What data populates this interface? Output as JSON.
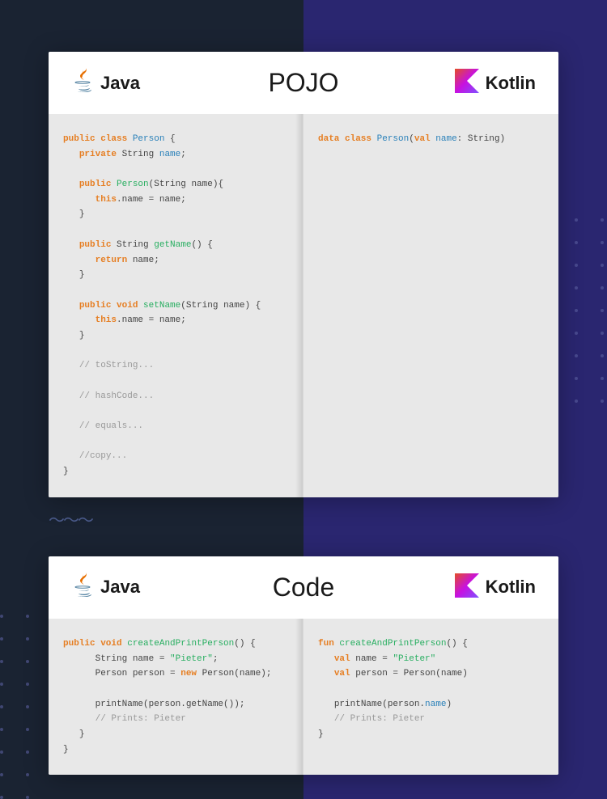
{
  "card1": {
    "title": "POJO",
    "javaLabel": "Java",
    "kotlinLabel": "Kotlin",
    "javaCode": "<span class='kw'>public class</span> <span class='cls'>Person</span> {\n   <span class='kw'>private</span> String <span class='cls'>name</span>;\n\n   <span class='kw'>public</span> <span class='fn'>Person</span>(String name){\n      <span class='kw'>this</span>.name = name;\n   }\n\n   <span class='kw'>public</span> String <span class='fn'>getName</span>() {\n      <span class='kw'>return</span> name;\n   }\n\n   <span class='kw'>public void</span> <span class='fn'>setName</span>(String name) {\n      <span class='kw'>this</span>.name = name;\n   }\n\n   <span class='cmt'>// toString...</span>\n\n   <span class='cmt'>// hashCode...</span>\n\n   <span class='cmt'>// equals...</span>\n\n   <span class='cmt'>//copy...</span>\n}",
    "kotlinCode": "<span class='kw'>data class</span> <span class='cls'>Person</span>(<span class='kw'>val</span> <span class='cls'>name</span>: String)"
  },
  "card2": {
    "title": "Code",
    "javaLabel": "Java",
    "kotlinLabel": "Kotlin",
    "javaCode": "<span class='kw'>public void</span> <span class='fn'>createAndPrintPerson</span>() {\n      String name = <span class='str'>\"Pieter\"</span>;\n      Person person = <span class='kw'>new</span> Person(name);\n\n      printName(person.getName());\n      <span class='cmt'>// Prints: Pieter</span>\n   }\n}",
    "kotlinCode": "<span class='kw'>fun</span> <span class='fn'>createAndPrintPerson</span>() {\n   <span class='kw'>val</span> name = <span class='str'>\"Pieter\"</span>\n   <span class='kw'>val</span> person = Person(name)\n\n   printName(person.<span class='cls'>name</span>)\n   <span class='cmt'>// Prints: Pieter</span>\n}"
  },
  "waves": "〜〜〜"
}
